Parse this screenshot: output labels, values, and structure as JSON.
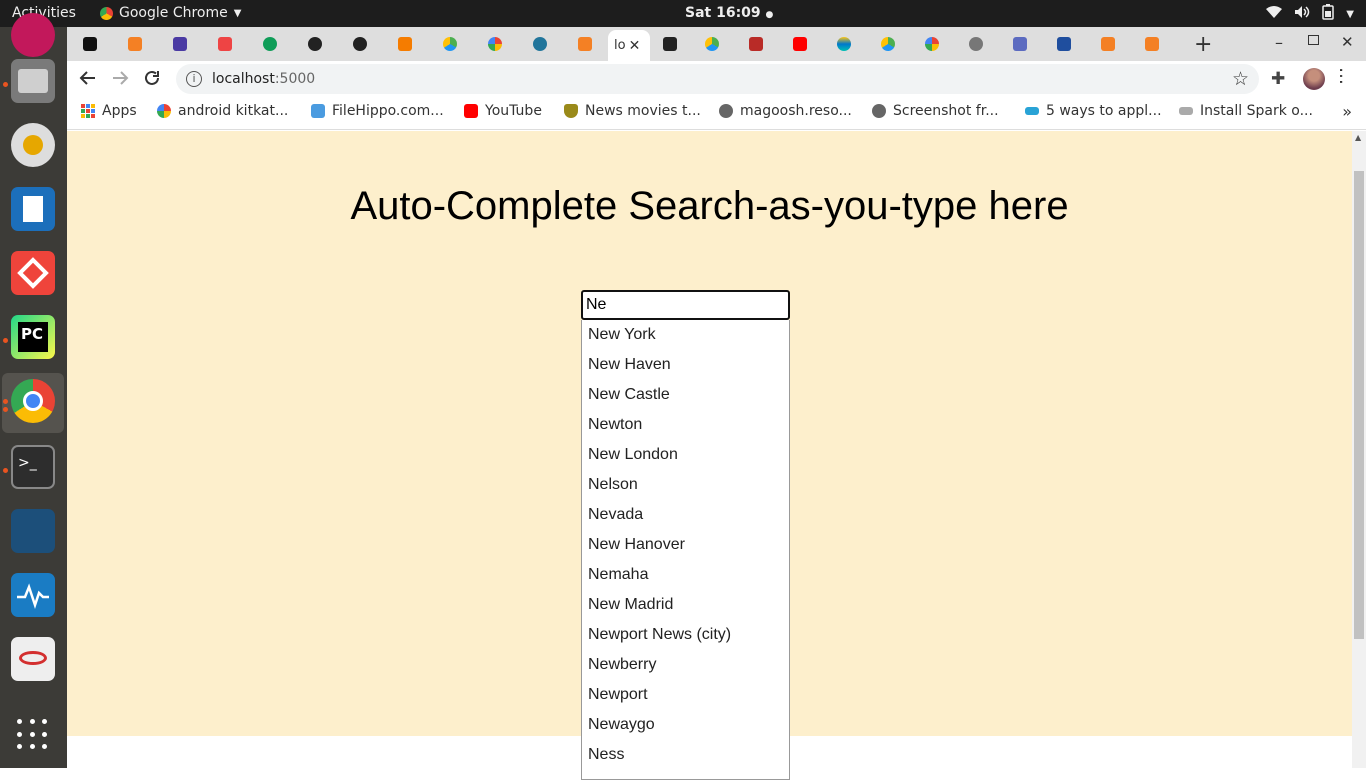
{
  "system": {
    "activities": "Activities",
    "app_name": "Google Chrome",
    "clock": "Sat 16:09"
  },
  "browser": {
    "active_tab_label": "lo",
    "url_host": "localhost",
    "url_port": ":5000",
    "bookmarks": [
      {
        "label": "Apps",
        "icon": "apps-grid-icon"
      },
      {
        "label": "android kitkat...",
        "icon": "google-icon"
      },
      {
        "label": "FileHippo.com...",
        "icon": "filehippo-icon"
      },
      {
        "label": "YouTube",
        "icon": "youtube-icon"
      },
      {
        "label": "News movies t...",
        "icon": "shield-icon"
      },
      {
        "label": "magoosh.reso...",
        "icon": "globe-icon"
      },
      {
        "label": "Screenshot fr...",
        "icon": "globe-icon"
      },
      {
        "label": "5 ways to appl...",
        "icon": "fish-icon"
      },
      {
        "label": "Install Spark o...",
        "icon": "spark-icon"
      }
    ]
  },
  "page": {
    "heading": "Auto-Complete Search-as-you-type here",
    "search_value": "Ne",
    "suggestions": [
      "New York",
      "New Haven",
      "New Castle",
      "Newton",
      "New London",
      "Nelson",
      "Nevada",
      "New Hanover",
      "Nemaha",
      "New Madrid",
      "Newport News (city)",
      "Newberry",
      "Newport",
      "Newaygo",
      "Ness"
    ]
  },
  "colors": {
    "page_bg": "#fdefcc",
    "dock_bg": "#3c3b37",
    "topbar_bg": "#1d1d1d",
    "tabstrip_bg": "#dedede"
  }
}
